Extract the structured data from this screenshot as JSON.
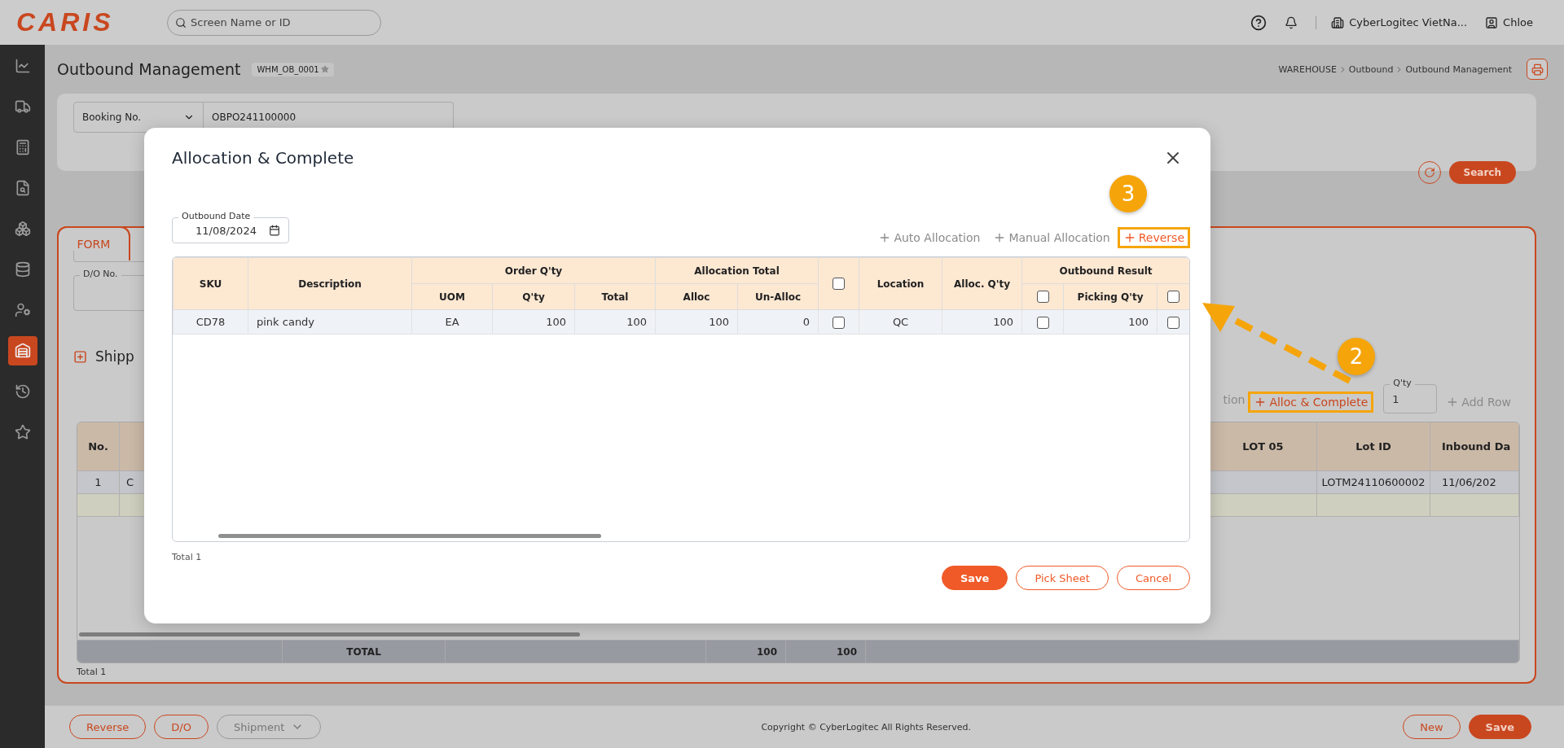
{
  "topbar": {
    "logo": "CARIS",
    "search": {
      "placeholder": "Screen Name or ID"
    },
    "company": "CyberLogitec VietNa...",
    "user": "Chloe"
  },
  "sidebar": {
    "items": [
      {
        "selected": false
      },
      {
        "selected": false
      },
      {
        "selected": false
      },
      {
        "selected": false
      },
      {
        "selected": false
      },
      {
        "selected": false
      },
      {
        "selected": false
      },
      {
        "selected": true
      },
      {
        "selected": false
      },
      {
        "selected": false
      }
    ]
  },
  "header": {
    "title": "Outbound Management",
    "screen_id": "WHM_OB_0001",
    "favorite": false,
    "breadcrumb": [
      "WAREHOUSE",
      "Outbound",
      "Outbound Management"
    ]
  },
  "search_panel": {
    "field": "Booking No.",
    "value": "OBPO241100000",
    "search_button": "Search"
  },
  "form": {
    "tabs": [
      {
        "label": "FORM",
        "selected": true
      }
    ],
    "do_field": {
      "label": "D/O No."
    },
    "section": "Shipp",
    "toolbar": [
      {
        "kind": "text",
        "label": "tion"
      },
      {
        "kind": "action",
        "label": "Alloc & Complete",
        "disabled": false,
        "highlighted": true
      },
      {
        "kind": "field",
        "label": "Q'ty",
        "value": "1"
      },
      {
        "kind": "action",
        "label": "Add Row",
        "disabled": true,
        "highlighted": false
      }
    ],
    "table": {
      "left_columns": [
        "No."
      ],
      "right_columns": [
        "LOT 05",
        "Lot ID",
        "Inbound Da"
      ],
      "rows": [
        {
          "kind": "data",
          "no": "1",
          "column_2": "C",
          "lot_id": "LOTM24110600002",
          "inbound_date": "11/06/202"
        },
        {
          "kind": "new"
        }
      ],
      "totals": {
        "label": "TOTAL",
        "values": [
          "100",
          "100"
        ]
      }
    },
    "total": "Total 1"
  },
  "bottom_bar": {
    "left_buttons": [
      {
        "label": "Reverse",
        "disabled": false,
        "dropdown": false
      },
      {
        "label": "D/O",
        "disabled": false,
        "dropdown": false
      },
      {
        "label": "Shipment",
        "disabled": true,
        "dropdown": true
      }
    ],
    "copyright": "Copyright © CyberLogitec All Rights Reserved.",
    "right_buttons": [
      {
        "label": "New",
        "kind": "outline"
      },
      {
        "label": "Save",
        "kind": "primary"
      }
    ]
  },
  "modal": {
    "title": "Allocation & Complete",
    "date": {
      "label": "Outbound Date",
      "value": "11/08/2024"
    },
    "actions": [
      {
        "label": "Auto Allocation",
        "disabled": true,
        "highlighted": false
      },
      {
        "label": "Manual Allocation",
        "disabled": true,
        "highlighted": false
      },
      {
        "label": "Reverse",
        "disabled": false,
        "highlighted": true
      }
    ],
    "table": {
      "columns": [
        {
          "label": "SKU",
          "kind": "code"
        },
        {
          "label": "Description",
          "kind": "text"
        },
        {
          "group": "Order Q'ty",
          "colspan": 3,
          "children": [
            {
              "label": "UOM",
              "kind": "code"
            },
            {
              "label": "Q'ty",
              "kind": "number"
            },
            {
              "label": "Total",
              "kind": "number"
            }
          ]
        },
        {
          "group": "Allocation Total",
          "colspan": 2,
          "children": [
            {
              "label": "Alloc",
              "kind": "number"
            },
            {
              "label": "Un-Alloc",
              "kind": "number"
            }
          ]
        },
        {
          "kind": "checkbox",
          "checked": false
        },
        {
          "label": "Location",
          "kind": "code"
        },
        {
          "label": "Alloc. Q'ty",
          "kind": "number"
        },
        {
          "group": "Outbound Result",
          "colspan": 3,
          "children": [
            {
              "kind": "checkbox",
              "checked": false
            },
            {
              "label": "Picking Q'ty",
              "kind": "number"
            },
            {
              "kind": "checkbox",
              "checked": false
            }
          ]
        }
      ],
      "rows": [
        {
          "cells": [
            "CD78",
            "pink candy",
            "EA",
            "100",
            "100",
            "100",
            "0",
            {
              "checked": false
            },
            "QC",
            "100",
            {
              "checked": false
            },
            "100",
            {
              "checked": false
            }
          ]
        }
      ]
    },
    "total": "Total 1",
    "buttons": [
      {
        "label": "Save",
        "kind": "primary"
      },
      {
        "label": "Pick Sheet",
        "kind": "outline"
      },
      {
        "label": "Cancel",
        "kind": "outline"
      }
    ]
  },
  "annotations": [
    {
      "number": "3"
    },
    {
      "number": "2"
    }
  ]
}
